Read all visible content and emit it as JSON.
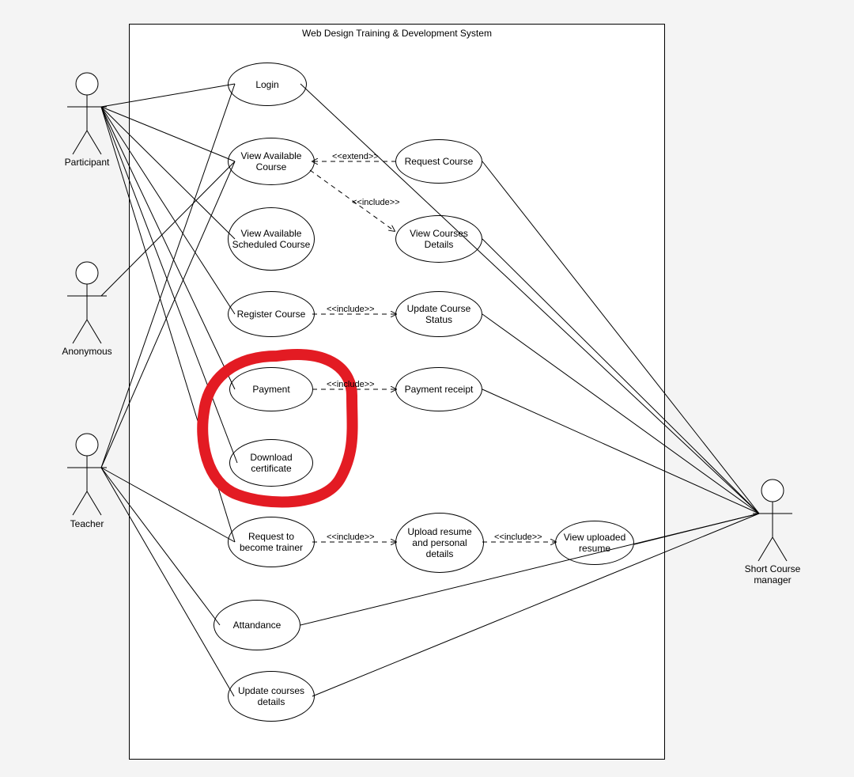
{
  "system_title": "Web Design Training & Development System",
  "actors": {
    "participant": "Participant",
    "anonymous": "Anonymous",
    "teacher": "Teacher",
    "manager": "Short Course manager"
  },
  "usecases": {
    "login": "Login",
    "view_available": "View Available Course",
    "view_sched": "View Available Scheduled Course",
    "register": "Register Course",
    "payment": "Payment",
    "download_cert": "Download certificate",
    "request_trainer": "Request to become trainer",
    "attendance": "Attandance",
    "update_courses": "Update courses details",
    "request_course": "Request Course",
    "view_details": "View Courses Details",
    "update_status": "Update Course Status",
    "payment_receipt": "Payment receipt",
    "upload_resume": "Upload resume and personal details",
    "view_uploaded": "View uploaded resume"
  },
  "rels": {
    "extend": "<<extend>>",
    "include1": "<<include>>",
    "include2": "<<include>>",
    "include3": "<<include>>",
    "include4": "<<include>>",
    "include5": "<<include>>"
  },
  "highlight": {
    "color": "#e31b23"
  }
}
